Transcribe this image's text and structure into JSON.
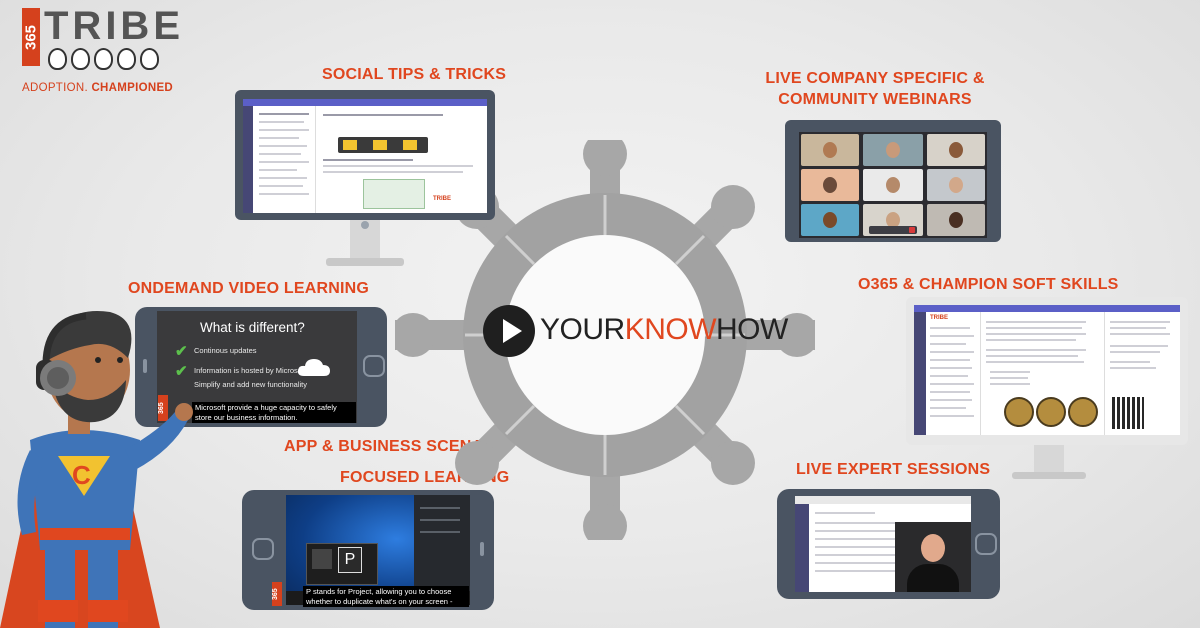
{
  "logo": {
    "number": "365",
    "word": "TRIBE",
    "tagline_prefix": "ADOPTION. ",
    "tagline_strong": "CHAMPIONED"
  },
  "headings": {
    "social_tips": "SOCIAL TIPS & TRICKS",
    "live_company_line1": "LIVE COMPANY SPECIFIC &",
    "live_company_line2": "COMMUNITY WEBINARS",
    "ondemand": "ONDEMAND VIDEO LEARNING",
    "soft_skills": "O365 & CHAMPION SOFT SKILLS",
    "app_business_line1": "APP & BUSINESS SCENARIO",
    "app_business_line2": "FOCUSED LEARNING",
    "live_expert": "LIVE EXPERT SESSIONS"
  },
  "center_brand": {
    "part1": "YOUR",
    "part2": "KNOW",
    "part3": "HOW"
  },
  "video_learning_screen": {
    "title": "What is different?",
    "items": [
      "Continous updates",
      "Information is hosted by Microsoft",
      "Simplify and add new functionality"
    ],
    "caption": "Microsoft provide a huge capacity to safely store our business information."
  },
  "business_screen": {
    "caption": "P stands for Project, allowing you to choose whether to duplicate what's on your screen -",
    "key_letter": "P"
  },
  "mascot": {
    "chest_letter": "C"
  },
  "colors": {
    "accent": "#e0471f",
    "device": "#4a5462",
    "teams": "#5b5fc7",
    "check": "#5cc04c"
  }
}
